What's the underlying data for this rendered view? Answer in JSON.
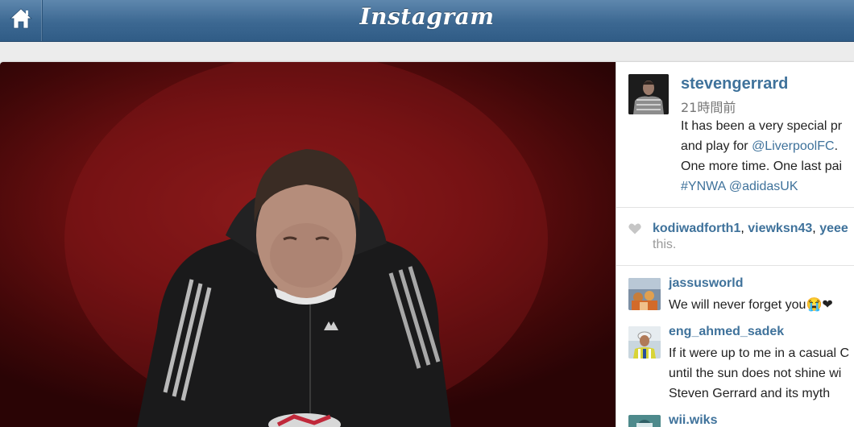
{
  "header": {
    "brand": "Instagram",
    "home_icon": "home-icon"
  },
  "post": {
    "owner": {
      "username": "stevengerrard",
      "timestamp": "21時間前"
    },
    "caption": {
      "line1": "It has been a very special pr",
      "line2_text": "and play for ",
      "line2_link": "@LiverpoolFC",
      "line2_end": ".",
      "line3": "One more time. One last pai",
      "tag1": "#YNWA",
      "tag2": "@adidasUK"
    },
    "likes": {
      "heart_icon": "heart-icon",
      "user1": "kodiwadforth1",
      "user2": "viewksn43",
      "user3": "yeee",
      "suffix": "this."
    },
    "comments": [
      {
        "username": "jassusworld",
        "lines": [
          "We will never forget you😭❤"
        ]
      },
      {
        "username": "eng_ahmed_sadek",
        "lines": [
          "If it were up to me in a casual C",
          "until the sun does not shine wi",
          "Steven Gerrard and its myth"
        ]
      },
      {
        "username": "wii.wiks",
        "lines": []
      }
    ]
  },
  "colors": {
    "header_blue": "#3c6892",
    "link_blue": "#3f729b",
    "photo_red": "#6a0f10"
  }
}
